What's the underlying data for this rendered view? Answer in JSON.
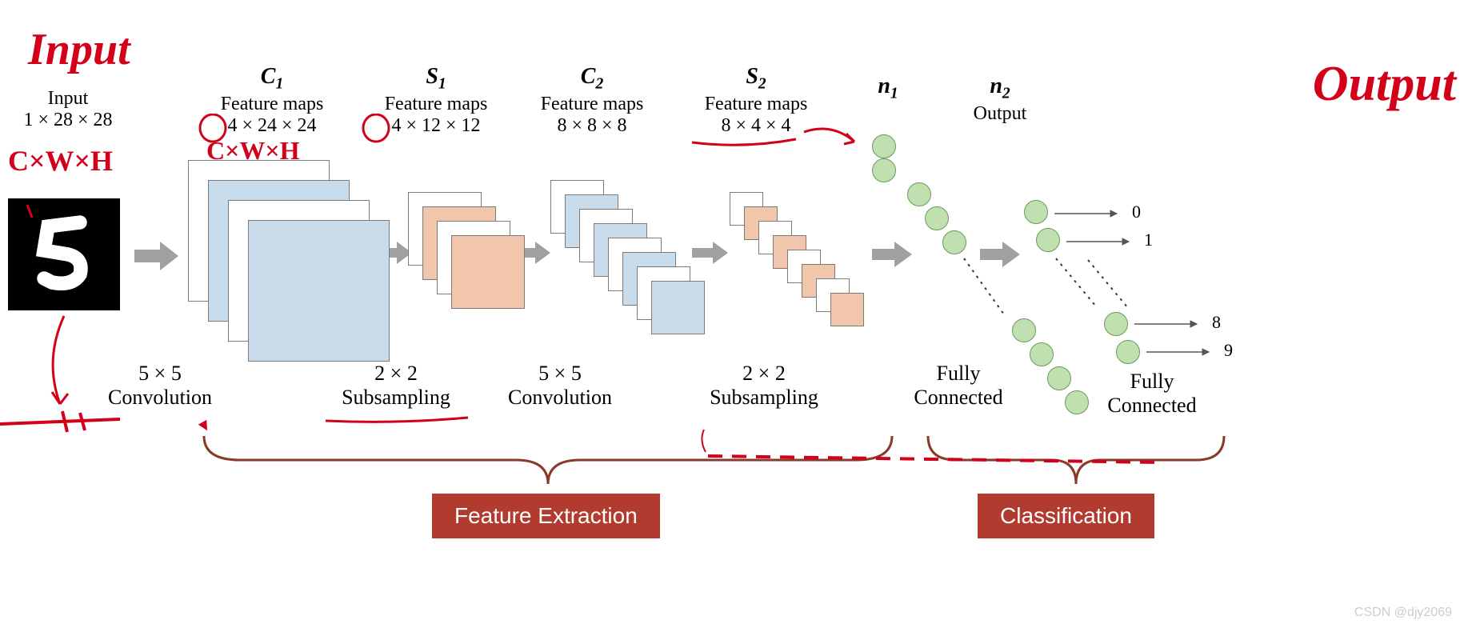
{
  "handwriting": {
    "input": "Input",
    "output": "Output",
    "cxwxh1": "C×W×H",
    "cxwxh2": "C×W×H"
  },
  "layers": {
    "input": {
      "title": "Input",
      "dim": "1 × 28 × 28"
    },
    "c1": {
      "symbol": "C",
      "sub": "1",
      "title": "Feature maps",
      "dim": "4 × 24 × 24"
    },
    "s1": {
      "symbol": "S",
      "sub": "1",
      "title": "Feature maps",
      "dim": "4 × 12 × 12"
    },
    "c2": {
      "symbol": "C",
      "sub": "2",
      "title": "Feature maps",
      "dim": "8 × 8 × 8"
    },
    "s2": {
      "symbol": "S",
      "sub": "2",
      "title": "Feature maps",
      "dim": "8 × 4 × 4"
    },
    "n1": {
      "symbol": "n",
      "sub": "1"
    },
    "n2": {
      "symbol": "n",
      "sub": "2",
      "title": "Output"
    }
  },
  "ops": {
    "conv1": {
      "size": "5 × 5",
      "name": "Convolution"
    },
    "sub1": {
      "size": "2 × 2",
      "name": "Subsampling"
    },
    "conv2": {
      "size": "5 × 5",
      "name": "Convolution"
    },
    "sub2": {
      "size": "2 × 2",
      "name": "Subsampling"
    },
    "fc1": "Fully\nConnected",
    "fc2": "Fully\nConnected"
  },
  "phases": {
    "fe": "Feature Extraction",
    "cl": "Classification"
  },
  "outputs": [
    "0",
    "1",
    "8",
    "9"
  ],
  "watermark": "CSDN @djy2069",
  "colors": {
    "blue": "#c8dceb",
    "orange": "#f2c6aa",
    "neuron": "#c0e0b0",
    "phase": "#b13b2e",
    "hand": "#d3001a",
    "arrow": "#a0a0a0"
  }
}
